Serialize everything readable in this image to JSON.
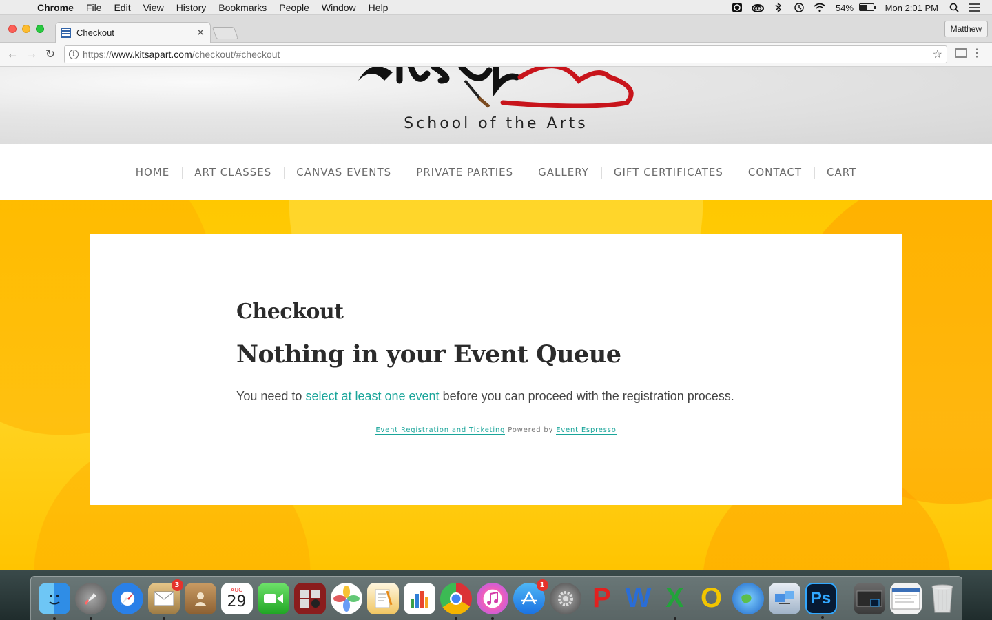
{
  "menubar": {
    "app_name": "Chrome",
    "items": [
      "File",
      "Edit",
      "View",
      "History",
      "Bookmarks",
      "People",
      "Window",
      "Help"
    ],
    "battery_percent": "54%",
    "clock": "Mon 2:01 PM"
  },
  "browser": {
    "tab_title": "Checkout",
    "profile_name": "Matthew",
    "url_prefix": "https://",
    "url_domain": "www.kitsapart.com",
    "url_path": "/checkout/#checkout"
  },
  "site": {
    "logo_subtitle": "School of the Arts",
    "nav": [
      "HOME",
      "ART CLASSES",
      "CANVAS EVENTS",
      "PRIVATE PARTIES",
      "GALLERY",
      "GIFT CERTIFICATES",
      "CONTACT",
      "CART"
    ]
  },
  "checkout": {
    "title": "Checkout",
    "heading": "Nothing in your Event Queue",
    "message_before": "You need to ",
    "message_link": "select at least one event",
    "message_after": " before you can proceed with the registration process.",
    "footer_link1": "Event Registration and Ticketing",
    "footer_text": " Powered by ",
    "footer_link2": "Event Espresso"
  },
  "dock": {
    "mail_badge": "3",
    "calendar_month": "AUG",
    "calendar_day": "29",
    "appstore_badge": "1"
  },
  "colors": {
    "accent_link": "#1aa59a",
    "page_background": "#ffcc1a"
  }
}
